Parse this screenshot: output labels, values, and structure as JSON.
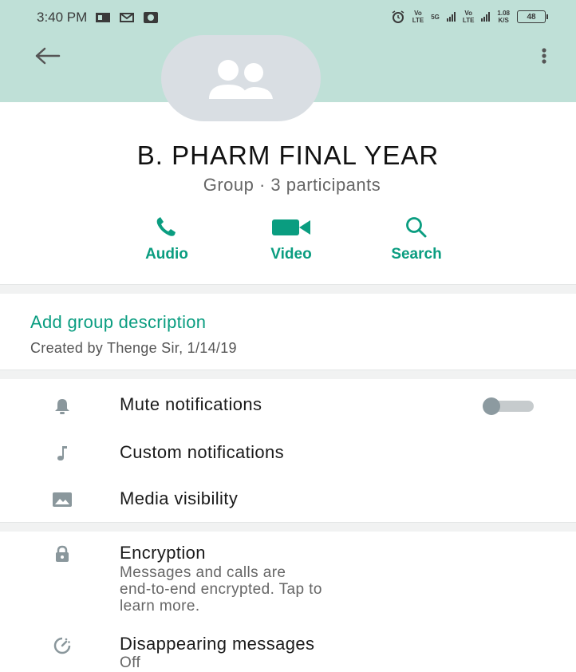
{
  "status_bar": {
    "time": "3:40 PM",
    "net1": "Vo\nLTE",
    "net2": "5G",
    "net3": "Vo\nLTE",
    "speed": "1.08\nK/S",
    "battery": "48"
  },
  "group": {
    "name": "B. PHARM FINAL YEAR",
    "subtitle": "Group · 3 participants"
  },
  "actions": {
    "audio": "Audio",
    "video": "Video",
    "search": "Search"
  },
  "description": {
    "add_label": "Add group description",
    "created_by": "Created by Thenge Sir, 1/14/19"
  },
  "settings": {
    "mute": "Mute notifications",
    "mute_enabled": false,
    "custom": "Custom notifications",
    "media": "Media visibility"
  },
  "security": {
    "encryption_title": "Encryption",
    "encryption_line1": "Messages and calls are",
    "encryption_line2": "end-to-end encrypted. Tap to",
    "encryption_line3": "learn more.",
    "disappearing_title": "Disappearing messages",
    "disappearing_value": "Off"
  },
  "colors": {
    "accent": "#0a9d80",
    "header": "#bfe0d7",
    "icon_gray": "#8a979c"
  },
  "icons": [
    "back-arrow",
    "overflow-menu",
    "group-avatar",
    "phone",
    "video-camera",
    "search",
    "bell",
    "music-note",
    "image",
    "lock",
    "timer"
  ]
}
